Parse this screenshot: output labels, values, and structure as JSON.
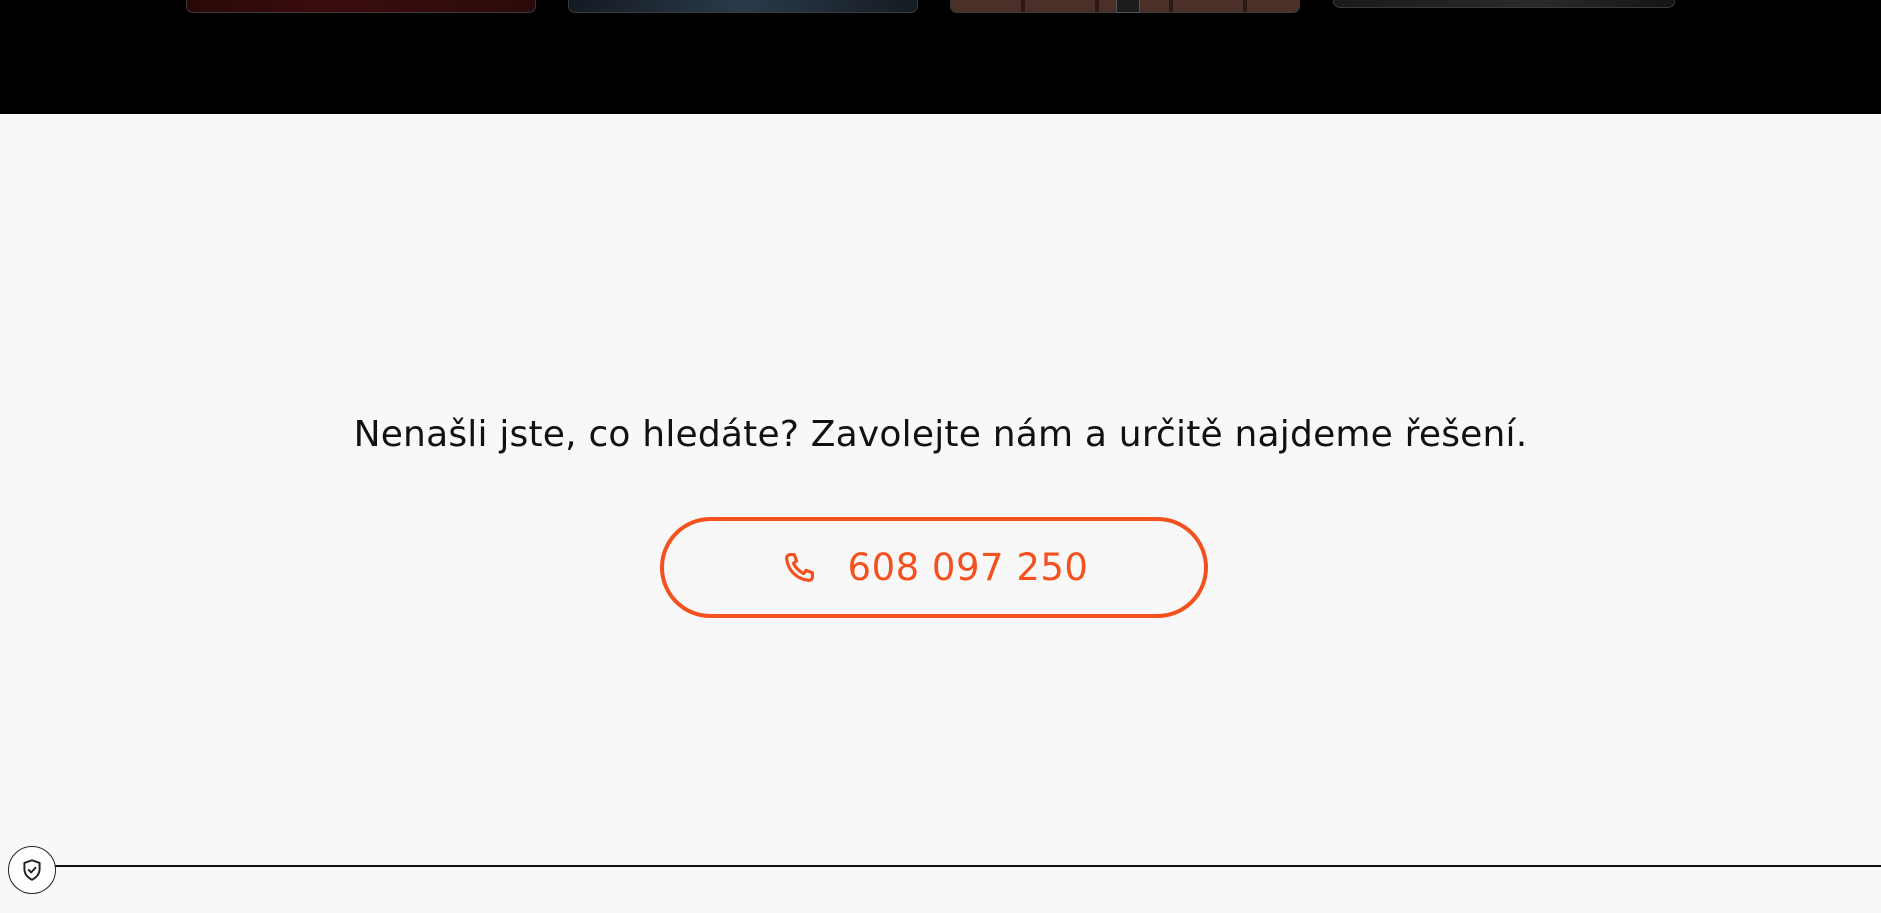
{
  "gallery": {
    "thumbnails": [
      "thumbnail-1",
      "thumbnail-2",
      "thumbnail-3",
      "thumbnail-4"
    ]
  },
  "cta": {
    "headline": "Nenašli jste, co hledáte? Zavolejte nám a určitě najdeme řešení.",
    "phone_label": "608 097 250",
    "phone_icon": "phone-icon"
  },
  "consent": {
    "icon": "shield-check-icon"
  },
  "colors": {
    "accent": "#f4511e",
    "background": "#f8f8f8",
    "top_strip": "#000000",
    "text": "#111111"
  }
}
